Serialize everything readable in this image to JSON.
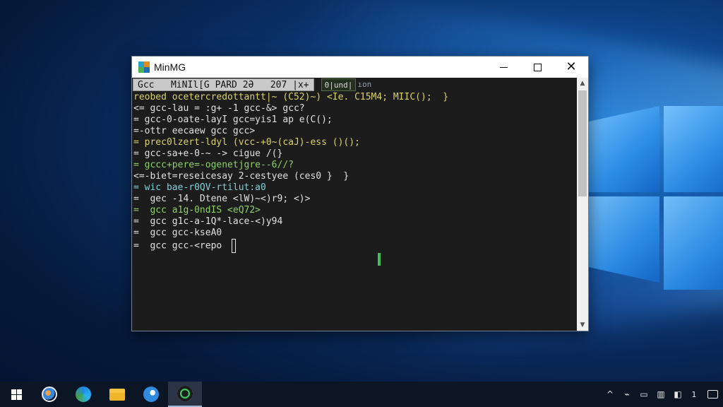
{
  "window": {
    "title": "MinMG",
    "controls": {
      "minimize": "",
      "maximize": "",
      "close": "✕"
    }
  },
  "console": {
    "tab_label": "Gcc   MiNIl[G PARD 2Ə   207 |x+",
    "tab_extra": "0|und|",
    "tab_extra2": "ıon",
    "lines": [
      {
        "t": "reobed ocetercredottantt|~ (C52)~) <Ie. C15M4; MIIC();  }",
        "c": "yel"
      },
      {
        "t": "<= gcc-lau = :g+ -1 gcc-&> gcc?",
        "c": "wht"
      },
      {
        "t": "= gcc-0-oate-layI gcc=yis1 ap e(C();",
        "c": "wht"
      },
      {
        "t": "=-ottr eecaew gcc gcc>",
        "c": "wht"
      },
      {
        "t": "= prec0lzert-ldyl (vcc-+0~(caJ)-ess ()();",
        "c": "yel"
      },
      {
        "t": "= gcc-sa+e-0-~ -> cigue /(}",
        "c": "wht"
      },
      {
        "t": "= gccc+pere=-ogenetjgre--6//?",
        "c": "grn"
      },
      {
        "t": "<=-biet=reseicesay 2-cestyee (ces0 }  }",
        "c": "wht"
      },
      {
        "t": "= wic bae-r0QV-rtilut:a0",
        "c": "cyn"
      },
      {
        "t": "=  gec -14. Dtene <lW)~<)r9; <)>",
        "c": "wht"
      },
      {
        "t": "=  gcc a1g-0ndIS <eQ72>",
        "c": "grn"
      },
      {
        "t": "=  gcc g1c-a-1Q*-lace-<)y94",
        "c": "wht"
      },
      {
        "t": "=  gcc gcc-kseA0",
        "c": "wht"
      },
      {
        "t": "=  gcc gcc-<repo",
        "c": "wht",
        "cursor": true
      }
    ]
  },
  "taskbar": {
    "apps": [
      {
        "name": "search",
        "icon": "search-icon"
      },
      {
        "name": "edge",
        "icon": "edge-icon"
      },
      {
        "name": "file-explorer",
        "icon": "folder-icon"
      },
      {
        "name": "store",
        "icon": "store-icon"
      },
      {
        "name": "terminal",
        "icon": "terminal-icon",
        "active": true
      }
    ],
    "tray": {
      "chevron": "^",
      "network": "⌁",
      "battery": "▭",
      "volume": "▥",
      "language": "◧",
      "clock": "1",
      "notifications": ""
    }
  },
  "colors": {
    "yel": "#d8d26a",
    "grn": "#8fcf6a",
    "cyn": "#7fd0d8",
    "wht": "#e0e0e0"
  }
}
